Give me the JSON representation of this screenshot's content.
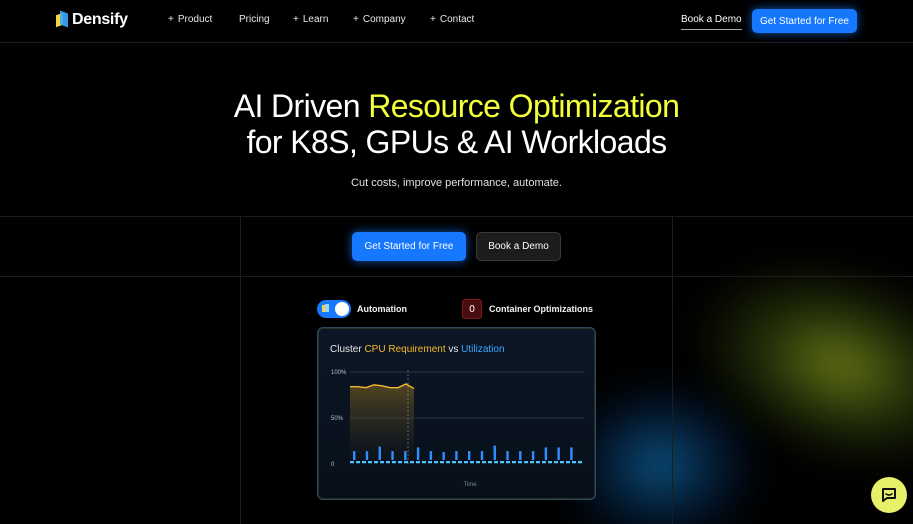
{
  "nav": {
    "logo_text": "Densify",
    "items": [
      {
        "label": "Product",
        "plus": "+"
      },
      {
        "label": "Pricing",
        "plus": ""
      },
      {
        "label": "Learn",
        "plus": "+"
      },
      {
        "label": "Company",
        "plus": "+"
      },
      {
        "label": "Contact",
        "plus": "+"
      }
    ],
    "book_demo": "Book a Demo",
    "get_started": "Get Started for Free"
  },
  "hero": {
    "line1_prefix": "AI Driven ",
    "line1_highlight": "Resource Optimization",
    "line2": "for K8S, GPUs & AI Workloads",
    "subtitle": "Cut costs, improve performance, automate.",
    "cta_primary": "Get Started for Free",
    "cta_secondary": "Book a Demo"
  },
  "controls": {
    "automation_label": "Automation",
    "automation_on": true,
    "counter_value": "0",
    "counter_label": "Container Optimizations"
  },
  "chart_card": {
    "title_prefix": "Cluster ",
    "title_req": "CPU Requirement",
    "title_mid": " vs ",
    "title_util": "Utilization"
  },
  "chart_data": {
    "type": "area",
    "title": "Cluster CPU Requirement vs Utilization",
    "xlabel": "Time",
    "ylabel": "",
    "yticks": [
      "100%",
      "50%",
      "0"
    ],
    "ylim": [
      0,
      100
    ],
    "grid": true,
    "series": [
      {
        "name": "CPU Requirement",
        "color": "#f5b82a",
        "values": [
          84,
          84,
          83,
          86,
          85,
          83,
          83,
          87,
          82
        ]
      },
      {
        "name": "Utilization",
        "color": "#3aa9ff",
        "values": [
          14,
          21,
          14,
          19,
          19,
          20,
          14,
          20,
          14,
          19,
          18,
          20,
          14,
          18,
          13,
          18,
          14,
          22,
          14,
          20,
          14,
          19,
          20,
          17,
          14,
          17,
          14,
          21,
          14,
          20,
          18,
          14,
          18,
          14,
          18,
          14
        ]
      }
    ],
    "baseline_value": 2,
    "cursor_index": 8,
    "colors": {
      "requirement": "#f5b82a",
      "utilization": "#2f8fff",
      "baseline": "#4fc3ff"
    }
  },
  "chat": {
    "icon": "chat-bubble-icon"
  }
}
